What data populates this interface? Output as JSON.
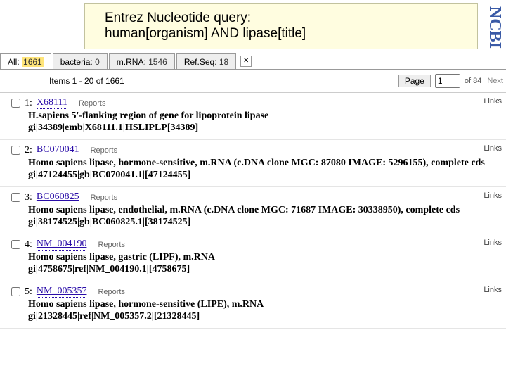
{
  "banner": {
    "line1": "Entrez Nucleotide query:",
    "line2": "human[organism] AND lipase[title]",
    "ncbi": "NCBI"
  },
  "tabs": {
    "all": {
      "label": "All:",
      "count": "1661",
      "count_hl": "1661"
    },
    "bacteria": {
      "label": "bacteria:",
      "count": "0"
    },
    "mrna": {
      "label": "m.RNA:",
      "count": "1546"
    },
    "refseq": {
      "label": "Ref.Seq:",
      "count": "18"
    }
  },
  "toolbar": {
    "items_range": "Items 1 - 20 of 1661",
    "page_label": "Page",
    "page_value": "1",
    "of_label": "of 84",
    "next_label": "Next"
  },
  "results": [
    {
      "idx": "1:",
      "acc": "X68111",
      "reports": "Reports",
      "desc": "H.sapiens 5'-flanking region of gene for lipoprotein lipase",
      "gi": "gi|34389|emb|X68111.1|HSLIPLP[34389]",
      "links": "Links"
    },
    {
      "idx": "2:",
      "acc": "BC070041",
      "reports": "Reports",
      "desc": "Homo sapiens lipase, hormone-sensitive, m.RNA (c.DNA clone MGC: 87080 IMAGE: 5296155), complete cds",
      "gi": "gi|47124455|gb|BC070041.1|[47124455]",
      "links": "Links"
    },
    {
      "idx": "3:",
      "acc": "BC060825",
      "reports": "Reports",
      "desc": "Homo sapiens lipase, endothelial, m.RNA (c.DNA clone MGC: 71687 IMAGE: 30338950), complete cds",
      "gi": "gi|38174525|gb|BC060825.1|[38174525]",
      "links": "Links"
    },
    {
      "idx": "4:",
      "acc": "NM_004190",
      "reports": "Reports",
      "desc": "Homo sapiens lipase, gastric (LIPF), m.RNA",
      "gi": "gi|4758675|ref|NM_004190.1|[4758675]",
      "links": "Links"
    },
    {
      "idx": "5:",
      "acc": "NM_005357",
      "reports": "Reports",
      "desc": "Homo sapiens lipase, hormone-sensitive (LIPE), m.RNA",
      "gi": "gi|21328445|ref|NM_005357.2|[21328445]",
      "links": "Links"
    }
  ]
}
